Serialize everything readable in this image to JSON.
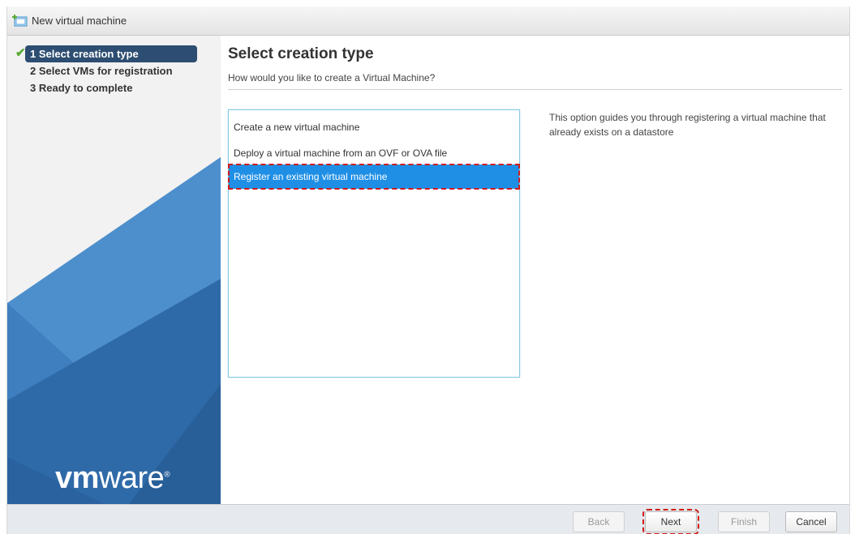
{
  "window": {
    "title": "New virtual machine",
    "icon": "new-vm-icon"
  },
  "sidebar": {
    "steps": [
      {
        "label": "1 Select creation type",
        "active": true,
        "completed": true
      },
      {
        "label": "2 Select VMs for registration",
        "active": false
      },
      {
        "label": "3 Ready to complete",
        "active": false
      }
    ],
    "check_mark": "✔",
    "logo_bold": "vm",
    "logo_light": "ware",
    "logo_mark": "®"
  },
  "main": {
    "title": "Select creation type",
    "subtitle": "How would you like to create a Virtual Machine?",
    "options": [
      {
        "label": "Create a new virtual machine",
        "selected": false
      },
      {
        "label": "Deploy a virtual machine from an OVF or OVA file",
        "selected": false
      },
      {
        "label": "Register an existing virtual machine",
        "selected": true
      }
    ],
    "description": "This option guides you through registering a virtual machine that already exists on a datastore"
  },
  "footer": {
    "back_label": "Back",
    "next_label": "Next",
    "finish_label": "Finish",
    "cancel_label": "Cancel"
  },
  "colors": {
    "accent": "#1f8fe6",
    "active_step": "#2d4e72",
    "check": "#5aa832",
    "highlight": "#d01a1a"
  }
}
